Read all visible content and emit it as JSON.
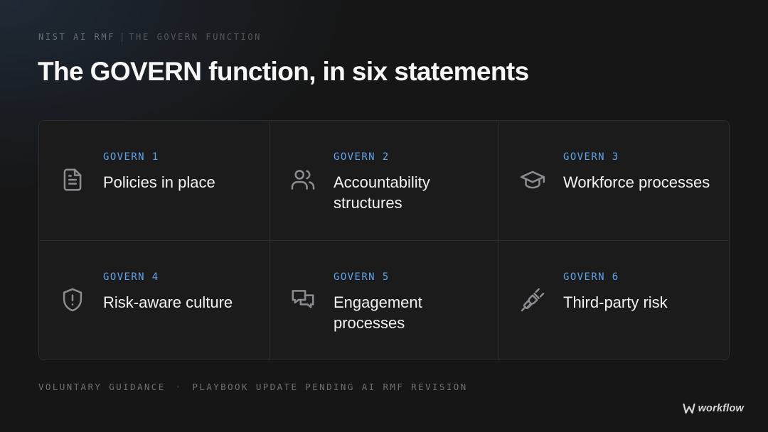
{
  "header": {
    "eyebrow_main": "NIST AI RMF",
    "eyebrow_sep": "|",
    "eyebrow_sub": "THE GOVERN FUNCTION",
    "title": "The GOVERN function, in six statements"
  },
  "statements": [
    {
      "label": "GOVERN 1",
      "text": "Policies in place",
      "icon": "document-icon"
    },
    {
      "label": "GOVERN 2",
      "text": "Accountability structures",
      "icon": "people-icon"
    },
    {
      "label": "GOVERN 3",
      "text": "Workforce processes",
      "icon": "graduation-cap-icon"
    },
    {
      "label": "GOVERN 4",
      "text": "Risk-aware culture",
      "icon": "shield-alert-icon"
    },
    {
      "label": "GOVERN 5",
      "text": "Engagement processes",
      "icon": "chat-bubbles-icon"
    },
    {
      "label": "GOVERN 6",
      "text": "Third-party risk",
      "icon": "plug-icon"
    }
  ],
  "footer": {
    "left": "VOLUNTARY GUIDANCE",
    "dot": "·",
    "right": "PLAYBOOK UPDATE PENDING AI RMF REVISION"
  },
  "brand": {
    "name": "workflow"
  },
  "colors": {
    "accent": "#5fa3e8",
    "background": "#161616",
    "card": "#1b1b1c",
    "icon": "#8a8c90"
  }
}
